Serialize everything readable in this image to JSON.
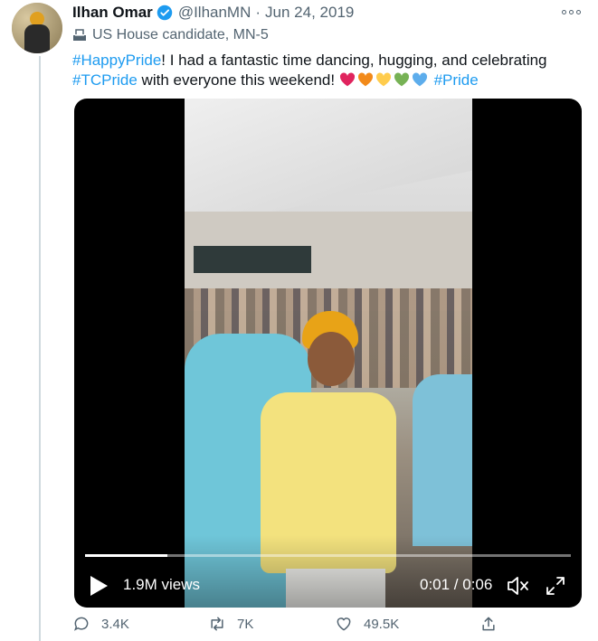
{
  "tweet": {
    "author_name": "Ilhan Omar",
    "handle": "@IlhanMN",
    "separator": "·",
    "date": "Jun 24, 2019",
    "candidate_label": "US House candidate, MN-5",
    "text": {
      "hashtag_happy_pride": "#HappyPride",
      "line1_rest": "! I had a fantastic time  dancing, hugging, and celebrating",
      "hashtag_tc_pride": "#TCPride",
      "line2_rest": " with everyone this weekend! ",
      "hashtag_pride": "#Pride"
    },
    "heart_colors": [
      "#e0245e",
      "#f28a1a",
      "#ffcc4d",
      "#77b255",
      "#5dadec"
    ],
    "accent_color": "#1d9bf0"
  },
  "video": {
    "views": "1.9M views",
    "time": "0:01 / 0:06",
    "progress": 0.17
  },
  "actions": {
    "replies": "3.4K",
    "retweets": "7K",
    "likes": "49.5K"
  },
  "icons": [
    "verified-badge-icon",
    "more-icon",
    "ballot-box-icon",
    "play-icon",
    "mute-icon",
    "fullscreen-icon",
    "reply-icon",
    "retweet-icon",
    "like-icon",
    "share-icon"
  ]
}
